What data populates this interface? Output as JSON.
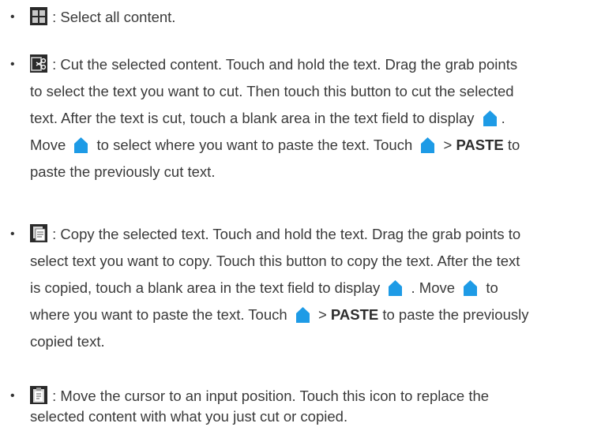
{
  "items": [
    {
      "icon": "select-all-icon",
      "lines": [
        ": Select all content."
      ]
    },
    {
      "icon": "cut-icon",
      "lines": [
        ": Cut the selected content. Touch and hold the text. Drag the grab points",
        "to select the text you want to cut. Then touch this button to cut the selected",
        "text. After the text is cut, touch a blank area in the text field to display",
        "Move",
        "to select where you want to paste the text. Touch",
        "PASTE",
        "to",
        "paste the previously cut text."
      ]
    },
    {
      "icon": "copy-icon",
      "lines": [
        ": Copy the selected text. Touch and hold the text. Drag the grab points to",
        "select text you want to copy. Touch this button to copy the text. After the text",
        "is copied, touch a blank area in the text field to display",
        ". Move",
        "to",
        "where you want to paste the text. Touch",
        "PASTE",
        "to paste the previously",
        "copied text."
      ]
    },
    {
      "icon": "paste-icon",
      "lines": [
        ": Move the cursor to an input position. Touch this icon to replace the",
        "selected content with what you just cut or copied."
      ]
    }
  ],
  "symbols": {
    "bullet": "•",
    "gt": ">",
    "period": "."
  },
  "colors": {
    "handle": "#1e9be6",
    "icon_bg": "#2a2a2a"
  }
}
